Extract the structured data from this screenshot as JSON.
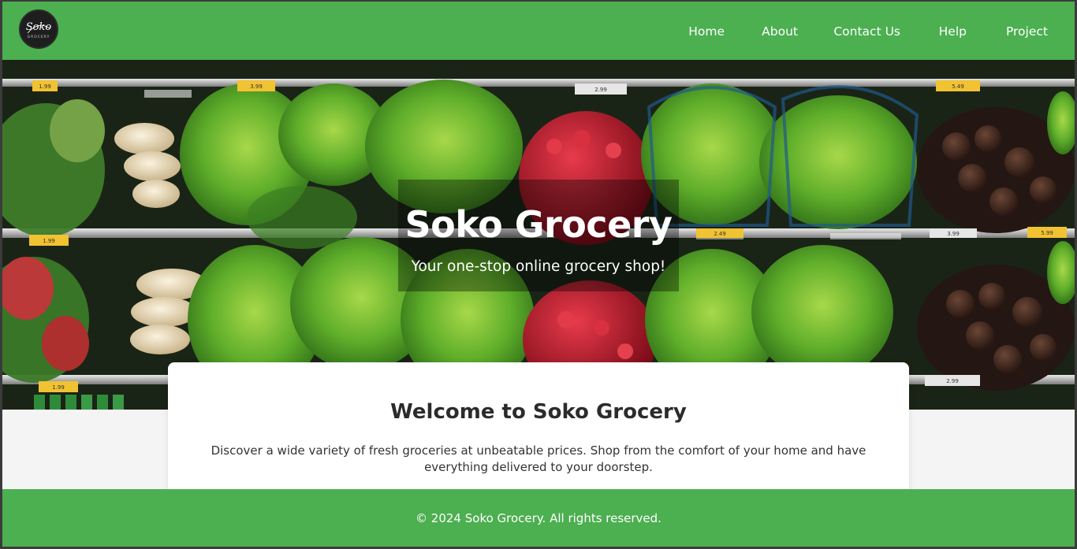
{
  "brand": {
    "logo_text": "Soko",
    "logo_subtext": "GROCERY"
  },
  "nav": {
    "items": [
      {
        "label": "Home"
      },
      {
        "label": "About"
      },
      {
        "label": "Contact Us"
      },
      {
        "label": "Help"
      },
      {
        "label": "Project"
      }
    ]
  },
  "hero": {
    "title": "Soko Grocery",
    "subtitle": "Your one-stop online grocery shop!",
    "price_tags": [
      "1.99",
      "3.99",
      "2.99",
      "5.49",
      "1.99",
      "2.49",
      "3.99",
      "5.99",
      "1.99",
      "2.99"
    ]
  },
  "welcome": {
    "heading": "Welcome to Soko Grocery",
    "text": "Discover a wide variety of fresh groceries at unbeatable prices. Shop from the comfort of your home and have everything delivered to your doorstep."
  },
  "footer": {
    "copyright": "© 2024 Soko Grocery. All rights reserved."
  },
  "colors": {
    "primary_green": "#4caf50",
    "background": "#f4f4f4",
    "card": "#ffffff"
  }
}
